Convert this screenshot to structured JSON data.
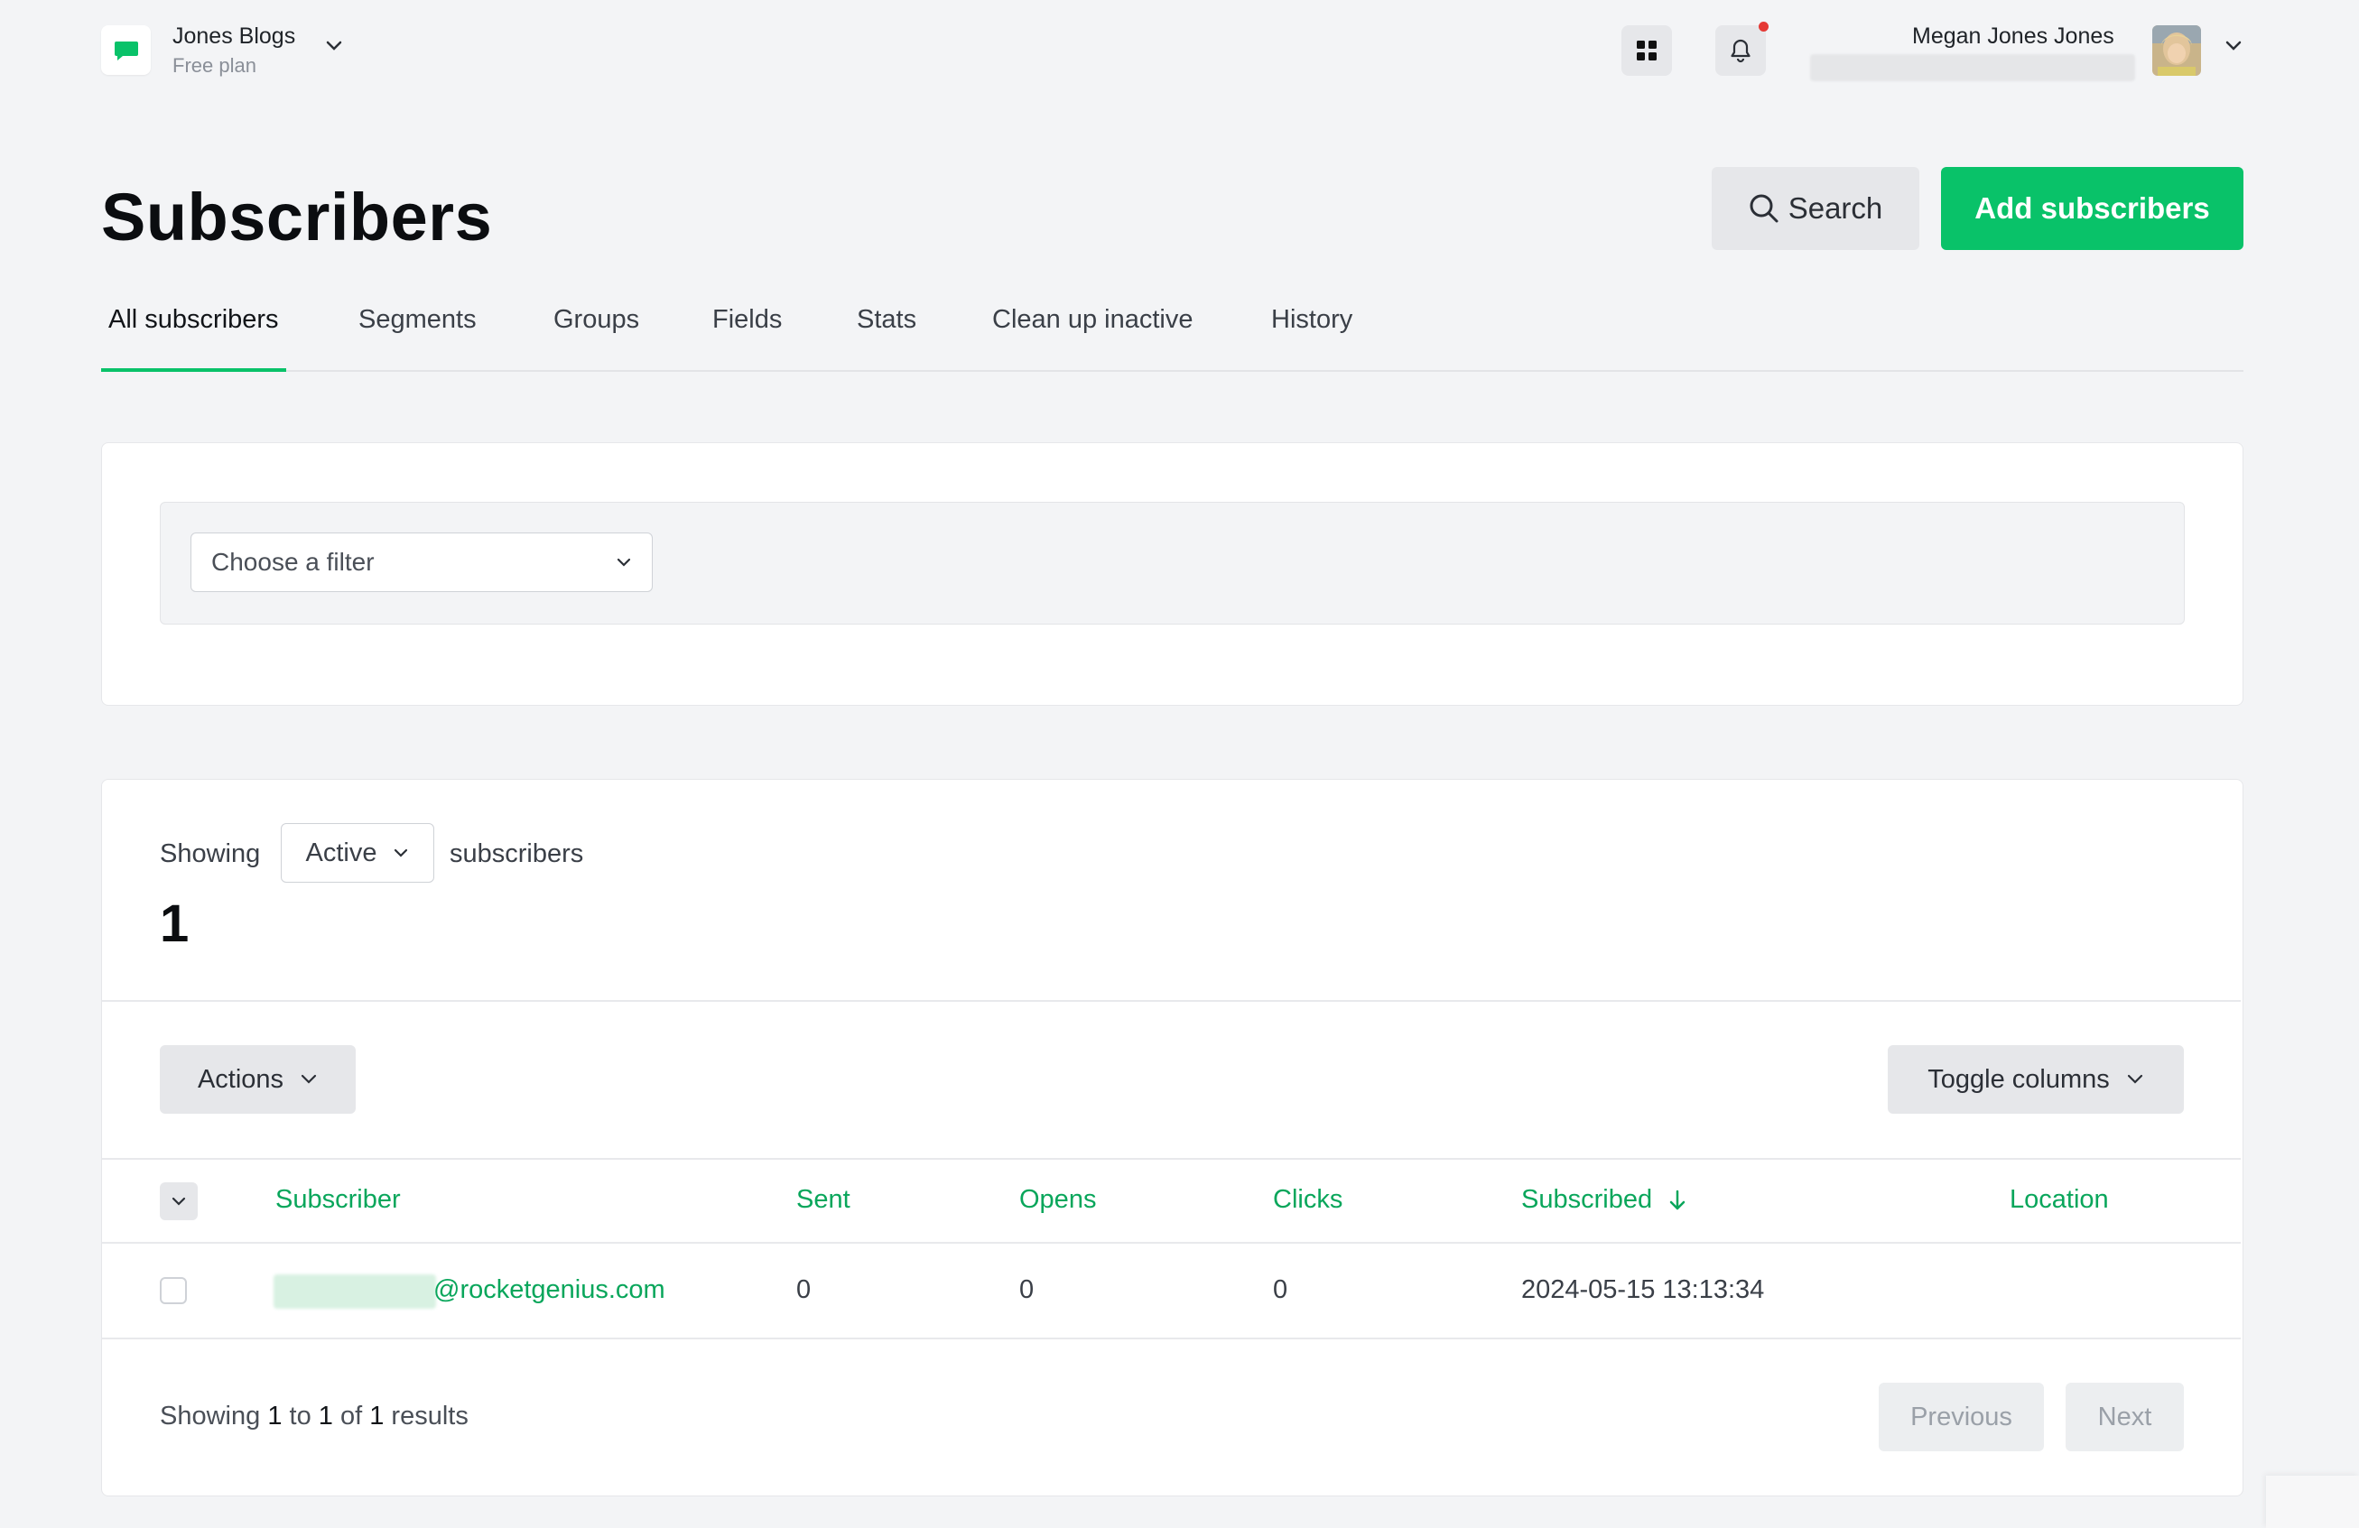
{
  "header": {
    "account_name": "Jones Blogs",
    "account_plan": "Free plan",
    "user_name": "Megan Jones Jones",
    "accent_color": "#09c269",
    "notification_dot_color": "#e53935"
  },
  "page": {
    "title": "Subscribers",
    "search_label": "Search",
    "add_label": "Add subscribers"
  },
  "tabs": [
    {
      "label": "All subscribers",
      "active": true
    },
    {
      "label": "Segments"
    },
    {
      "label": "Groups"
    },
    {
      "label": "Fields"
    },
    {
      "label": "Stats"
    },
    {
      "label": "Clean up inactive"
    },
    {
      "label": "History"
    }
  ],
  "filter": {
    "placeholder": "Choose a filter"
  },
  "summary": {
    "showing_label": "Showing",
    "status_value": "Active",
    "subscribers_label": "subscribers",
    "count": "1"
  },
  "toolbar": {
    "actions_label": "Actions",
    "toggle_columns_label": "Toggle columns"
  },
  "table": {
    "columns": [
      "Subscriber",
      "Sent",
      "Opens",
      "Clicks",
      "Subscribed",
      "Location"
    ],
    "rows": [
      {
        "email_domain": "@rocketgenius.com",
        "sent": "0",
        "opens": "0",
        "clicks": "0",
        "subscribed": "2024-05-15 13:13:34",
        "location": ""
      }
    ]
  },
  "pagination": {
    "showing_word": "Showing",
    "from": "1",
    "to_word": "to",
    "to": "1",
    "of_word": "of",
    "total": "1",
    "results_word": "results",
    "previous_label": "Previous",
    "next_label": "Next"
  }
}
